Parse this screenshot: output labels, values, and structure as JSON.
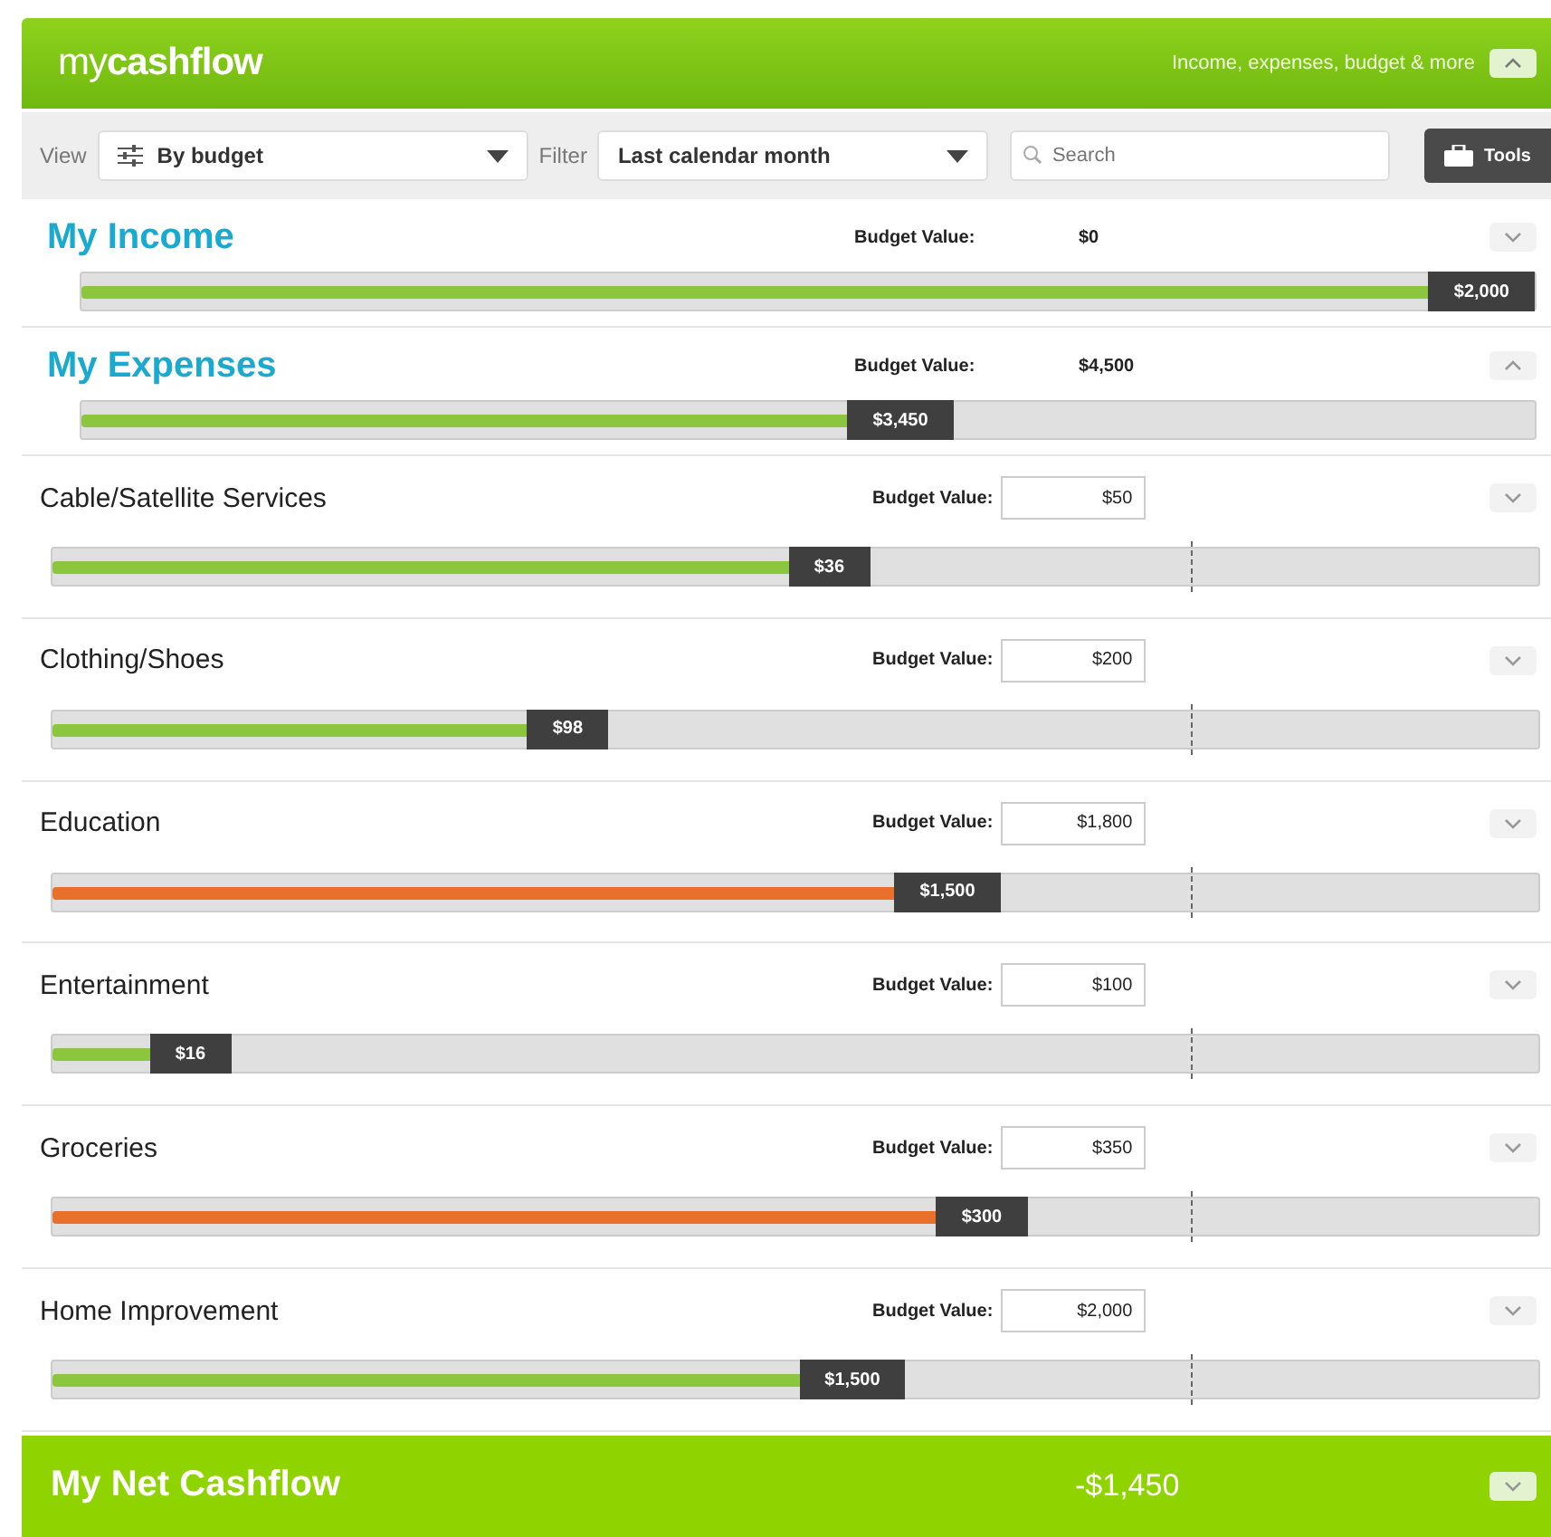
{
  "header": {
    "logo_light": "my",
    "logo_bold": "cashflow",
    "tagline": "Income, expenses, budget & more",
    "expanded": true
  },
  "toolbar": {
    "view_label": "View",
    "view_value": "By budget",
    "filter_label": "Filter",
    "filter_value": "Last calendar month",
    "search": {
      "placeholder": "Search"
    },
    "tools": "Tools"
  },
  "summaries": [
    {
      "title": "My Income",
      "budget_label": "Budget Value:",
      "budget_value": "$0",
      "amount": "$2,000",
      "level": 1.0,
      "expanded": false
    },
    {
      "title": "My Expenses",
      "budget_label": "Budget Value:",
      "budget_value": "$4,500",
      "amount": "$3,450",
      "level": 0.6,
      "expanded": true
    }
  ],
  "categories": [
    {
      "name": "Cable/Satellite Services",
      "budget_label": "Budget Value:",
      "budget_value": "$50",
      "amount": "$36",
      "level": 0.55,
      "color": "#8cc63f"
    },
    {
      "name": "Clothing/Shoes",
      "budget_label": "Budget Value:",
      "budget_value": "$200",
      "amount": "$98",
      "level": 0.374,
      "color": "#8cc63f"
    },
    {
      "name": "Education",
      "budget_label": "Budget Value:",
      "budget_value": "$1,800",
      "amount": "$1,500",
      "level": 0.638,
      "color": "#e8702a"
    },
    {
      "name": "Entertainment",
      "budget_label": "Budget Value:",
      "budget_value": "$100",
      "amount": "$16",
      "level": 0.12,
      "color": "#8cc63f"
    },
    {
      "name": "Groceries",
      "budget_label": "Budget Value:",
      "budget_value": "$350",
      "amount": "$300",
      "level": 0.656,
      "color": "#e8702a"
    },
    {
      "name": "Home Improvement",
      "budget_label": "Budget Value:",
      "budget_value": "$2,000",
      "amount": "$1,500",
      "level": 0.574,
      "color": "#8cc63f"
    }
  ],
  "net": {
    "title": "My Net Cashflow",
    "value": "-$1,450",
    "expanded": false
  }
}
